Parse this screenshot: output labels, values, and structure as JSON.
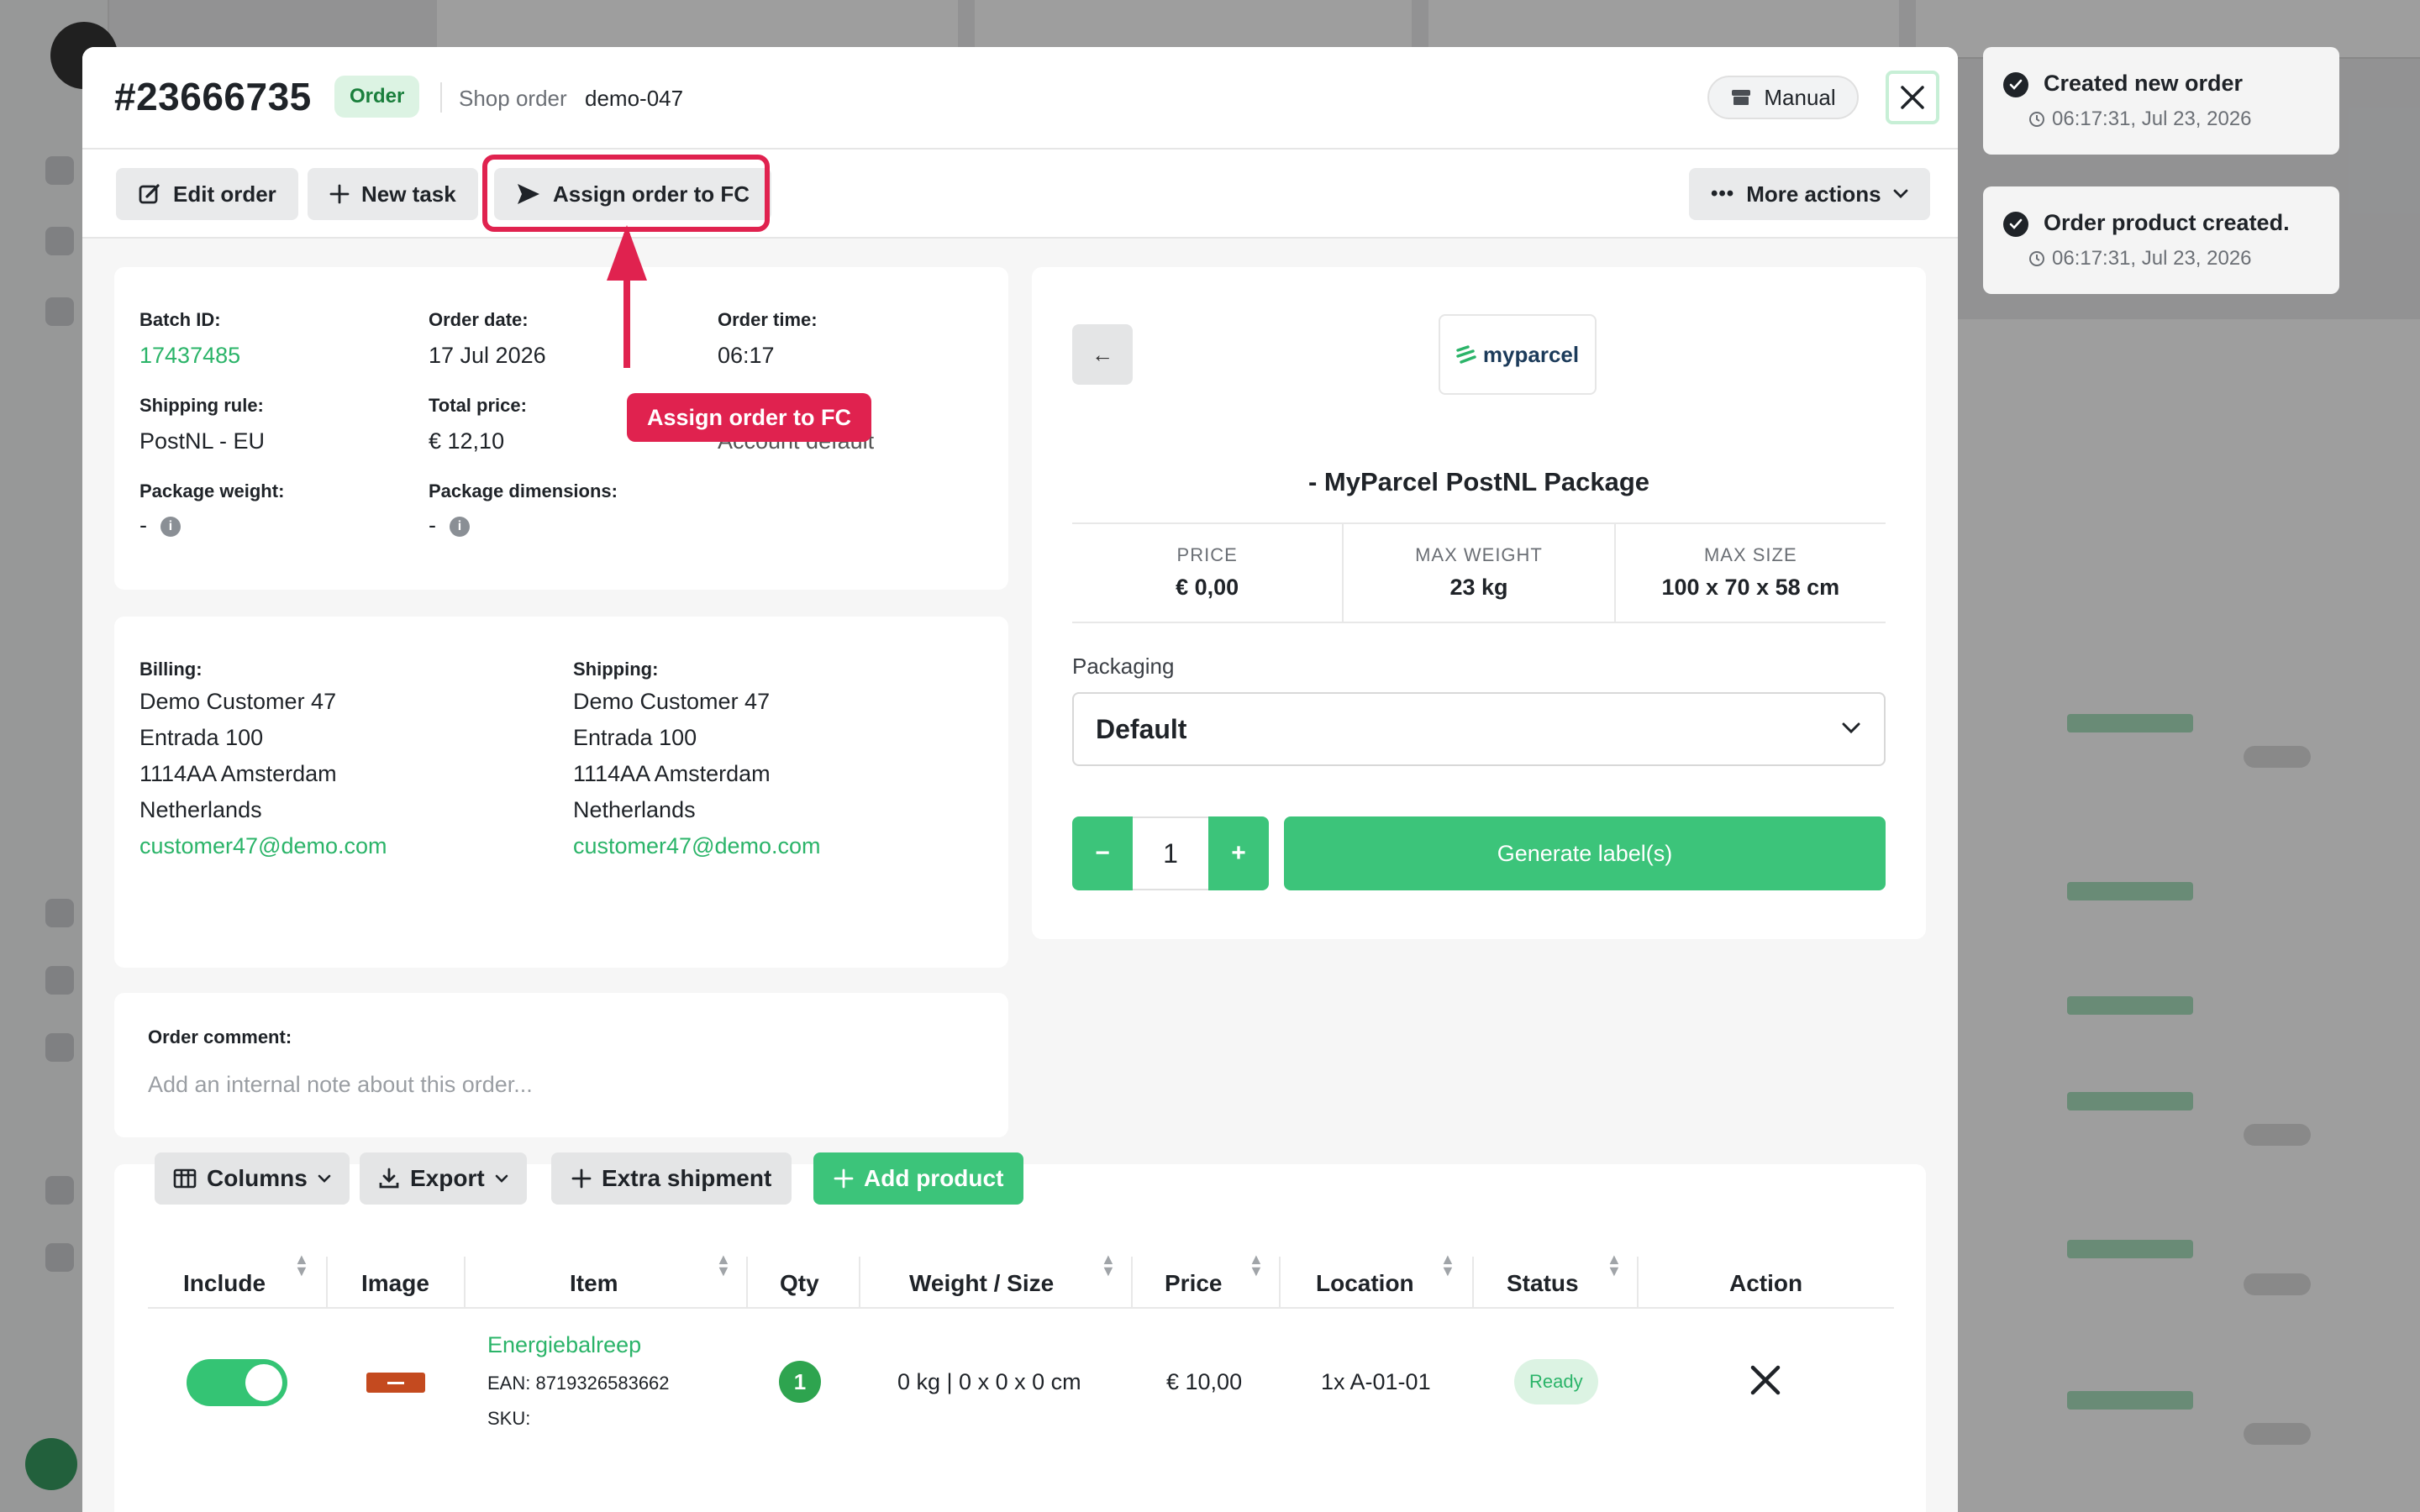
{
  "modal": {
    "order_number": "#23666735",
    "badge": "Order",
    "shop_order_label": "Shop order",
    "shop_order_value": "demo-047",
    "manual_label": "Manual"
  },
  "toolbar": {
    "edit_order": "Edit order",
    "new_task": "New task",
    "assign_fc": "Assign order to FC",
    "more_actions": "More actions"
  },
  "annotation": {
    "label": "Assign order to FC"
  },
  "order_details": {
    "batch_id_label": "Batch ID:",
    "batch_id": "17437485",
    "order_date_label": "Order date:",
    "order_date": "17 Jul 2026",
    "order_time_label": "Order time:",
    "order_time": "06:17",
    "shipping_rule_label": "Shipping rule:",
    "shipping_rule": "PostNL - EU",
    "total_price_label": "Total price:",
    "total_price": "€ 12,10",
    "hidden_value": "Account default",
    "package_weight_label": "Package weight:",
    "package_weight": "-",
    "package_dimensions_label": "Package dimensions:",
    "package_dimensions": "-",
    "info_glyph": "i"
  },
  "billing": {
    "label": "Billing:",
    "name": "Demo Customer 47",
    "street": "Entrada 100",
    "city": "1114AA Amsterdam",
    "country": "Netherlands",
    "email": "customer47@demo.com"
  },
  "shipping": {
    "label": "Shipping:",
    "name": "Demo Customer 47",
    "street": "Entrada 100",
    "city": "1114AA Amsterdam",
    "country": "Netherlands",
    "email": "customer47@demo.com"
  },
  "comment": {
    "label": "Order comment:",
    "placeholder": "Add an internal note about this order..."
  },
  "carrier": {
    "logo_text": "myparcel",
    "back_glyph": "←",
    "name": "- MyParcel PostNL Package",
    "price_label": "PRICE",
    "price": "€ 0,00",
    "max_weight_label": "MAX WEIGHT",
    "max_weight": "23 kg",
    "max_size_label": "MAX SIZE",
    "max_size": "100 x 70 x 58 cm",
    "packaging_label": "Packaging",
    "packaging_value": "Default",
    "minus": "−",
    "quantity": "1",
    "plus": "+",
    "generate_label": "Generate label(s)"
  },
  "products": {
    "buttons": {
      "columns": "Columns",
      "export": "Export",
      "extra_shipment": "Extra shipment",
      "add_product": "Add product"
    },
    "headers": {
      "include": "Include",
      "image": "Image",
      "item": "Item",
      "qty": "Qty",
      "weight_size": "Weight / Size",
      "price": "Price",
      "location": "Location",
      "status": "Status",
      "action": "Action"
    },
    "rows": [
      {
        "name": "Energiebalreep",
        "ean": "EAN: 8719326583662",
        "sku": "SKU:",
        "qty": "1",
        "weight_size": "0 kg | 0 x 0 x 0 cm",
        "price": "€ 10,00",
        "location": "1x A-01-01",
        "status": "Ready"
      }
    ]
  },
  "toasts": [
    {
      "title": "Created new order",
      "time": "06:17:31, Jul 23, 2026"
    },
    {
      "title": "Order product created.",
      "time": "06:17:31, Jul 23, 2026"
    }
  ],
  "colors": {
    "accent_green": "#3cc47a",
    "link_green": "#2bb469",
    "highlight_red": "#e0224f"
  }
}
